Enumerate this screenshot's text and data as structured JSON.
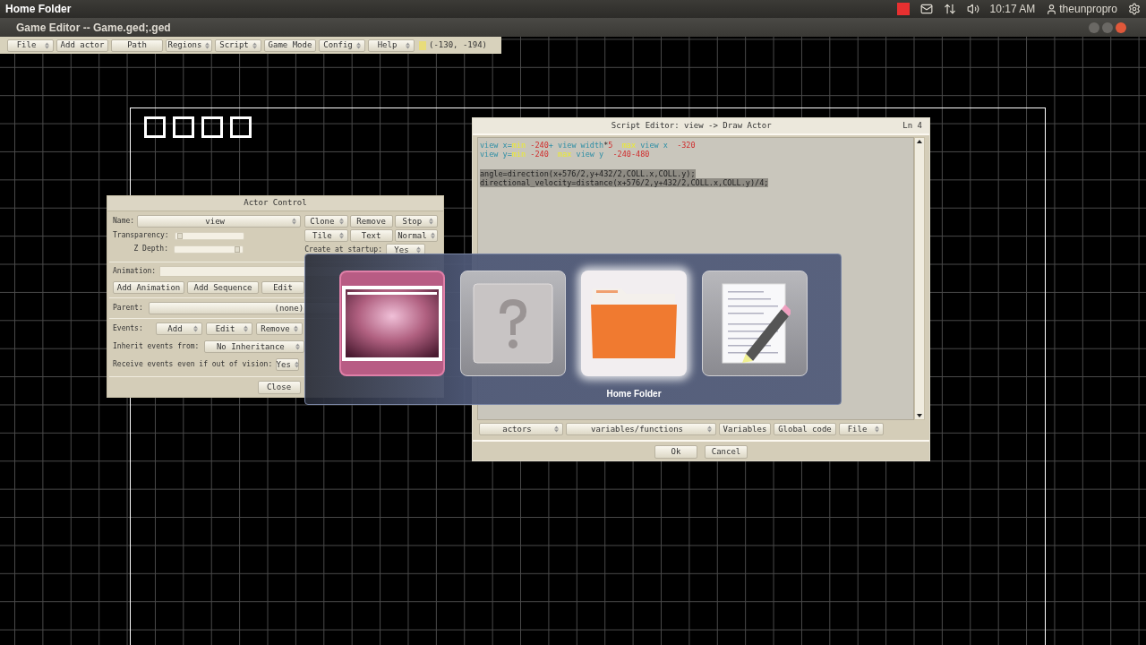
{
  "top_panel": {
    "title": "Home Folder",
    "clock": "10:17 AM",
    "user": "theunpropro"
  },
  "game_editor": {
    "title": "Game Editor -- Game.ged;.ged",
    "menu": [
      {
        "label": "File",
        "kind": "dropdown"
      },
      {
        "label": "Add actor",
        "kind": "button"
      },
      {
        "label": "Path",
        "kind": "button"
      },
      {
        "label": "Regions",
        "kind": "dropdown"
      },
      {
        "label": "Script",
        "kind": "dropdown"
      },
      {
        "label": "Game Mode",
        "kind": "button"
      },
      {
        "label": "Config",
        "kind": "dropdown"
      },
      {
        "label": "Help",
        "kind": "dropdown"
      }
    ],
    "coordinates": "(-130, -194)"
  },
  "actor_control": {
    "title": "Actor Control",
    "name_label": "Name:",
    "name_value": "view",
    "transparency": {
      "label": "Transparency:",
      "level": 0.04
    },
    "z_depth": {
      "label": "Z Depth:",
      "level": 0.96
    },
    "top_buttons": [
      {
        "label": "Clone",
        "kind": "dropdown"
      },
      {
        "label": "Remove",
        "kind": "button"
      },
      {
        "label": "Stop",
        "kind": "dropdown"
      },
      {
        "label": "Tile",
        "kind": "dropdown"
      },
      {
        "label": "Text",
        "kind": "button"
      },
      {
        "label": "Normal",
        "kind": "dropdown"
      }
    ],
    "startup_label": "Create at startup:",
    "startup_value": "Yes",
    "animation_label": "Animation:",
    "animation_buttons": [
      "Add Animation",
      "Add Sequence",
      "Edit"
    ],
    "parent_label": "Parent:",
    "parent_value": "(none)",
    "events_label": "Events:",
    "events_buttons": [
      "Add",
      "Edit",
      "Remove"
    ],
    "inherit_label": "Inherit events from:",
    "inherit_value": "No Inheritance",
    "receive_label": "Receive events even if out of vision:",
    "receive_value": "Yes",
    "close": "Close"
  },
  "script_editor": {
    "title": "Script Editor: view -> Draw Actor",
    "line_indicator": "Ln 4",
    "lines": [
      {
        "selected": false,
        "tokens": [
          {
            "text": "view x",
            "kind": "ident"
          },
          {
            "text": "=",
            "kind": "ident"
          },
          {
            "text": "min",
            "kind": "keyword"
          },
          {
            "text": " -240",
            "kind": "number"
          },
          {
            "text": "+ view width",
            "kind": "ident"
          },
          {
            "text": "*",
            "kind": "plain"
          },
          {
            "text": "5",
            "kind": "number"
          },
          {
            "text": "  max",
            "kind": "keyword"
          },
          {
            "text": " view x",
            "kind": "ident"
          },
          {
            "text": "  -320",
            "kind": "number"
          }
        ]
      },
      {
        "selected": false,
        "tokens": [
          {
            "text": "view y",
            "kind": "ident"
          },
          {
            "text": "=",
            "kind": "ident"
          },
          {
            "text": "min",
            "kind": "keyword"
          },
          {
            "text": " -240",
            "kind": "number"
          },
          {
            "text": "  max",
            "kind": "keyword"
          },
          {
            "text": " view y",
            "kind": "ident"
          },
          {
            "text": "  -240-480",
            "kind": "number"
          }
        ]
      },
      {
        "kind": "blank"
      },
      {
        "selected": true,
        "tokens": [
          {
            "text": "angle=direction(x+576/2,y+432/2,COLL.x,COLL.y);",
            "kind": "plain"
          }
        ]
      },
      {
        "selected": true,
        "tokens": [
          {
            "text": "directional_velocity=distance(x+576/2,y+432/2,COLL.x,COLL.y)/4;",
            "kind": "plain"
          }
        ]
      }
    ],
    "bottom_buttons": [
      {
        "label": "actors",
        "kind": "dropdown"
      },
      {
        "label": "variables/functions",
        "kind": "dropdown"
      },
      {
        "label": "Variables",
        "kind": "button"
      },
      {
        "label": "Global code",
        "kind": "button"
      },
      {
        "label": "File",
        "kind": "dropdown"
      }
    ],
    "ok": "Ok",
    "cancel": "Cancel"
  },
  "switcher": {
    "items": [
      {
        "kind": "workspaces",
        "selected": false
      },
      {
        "kind": "unknown",
        "selected": false
      },
      {
        "kind": "folder",
        "selected": true,
        "label": "Home Folder"
      },
      {
        "kind": "editor",
        "selected": false
      }
    ]
  }
}
